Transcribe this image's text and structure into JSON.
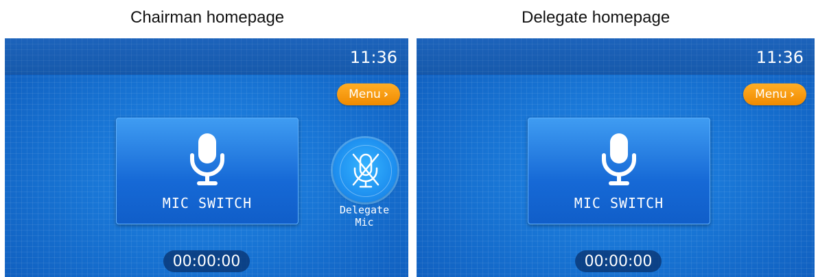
{
  "captions": {
    "left": "Chairman homepage",
    "right": "Delegate homepage"
  },
  "chairman": {
    "clock": "11:36",
    "menu_label": "Menu",
    "menu_chevron": "›",
    "mic_switch_label": "MIC SWITCH",
    "mic_icon": "microphone-icon",
    "delegate_mic_label_line1": "Delegate",
    "delegate_mic_label_line2": "Mic",
    "delegate_mic_icon": "microphone-muted-icon",
    "timer": "00:00:00"
  },
  "delegate": {
    "clock": "11:36",
    "menu_label": "Menu",
    "menu_chevron": "›",
    "mic_switch_label": "MIC SWITCH",
    "mic_icon": "microphone-icon",
    "timer": "00:00:00"
  },
  "colors": {
    "background_blue": "#1a6fd1",
    "menu_orange": "#f59a10",
    "timer_pill": "#0a3270"
  }
}
